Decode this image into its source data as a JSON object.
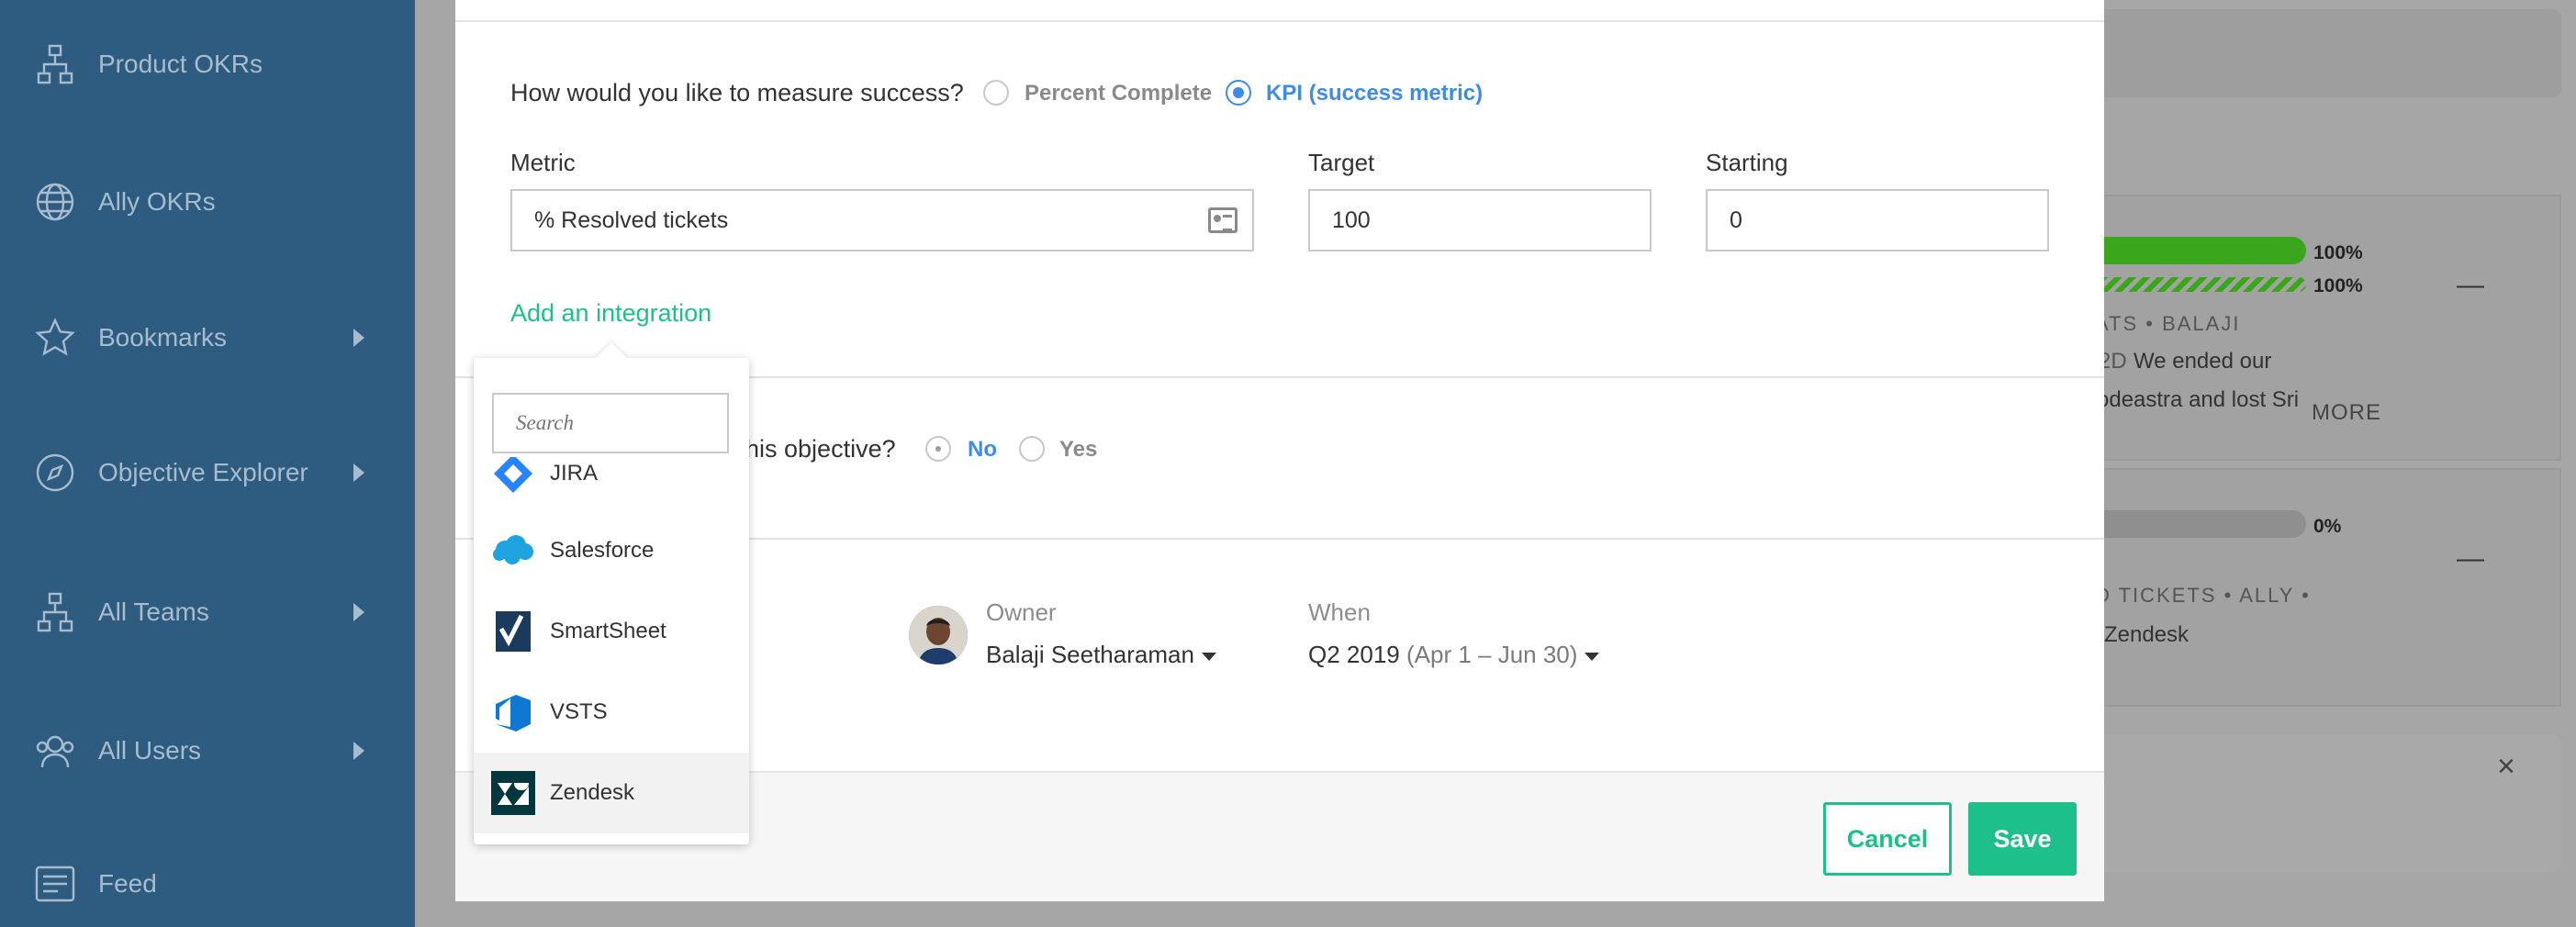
{
  "sidebar": {
    "items": [
      {
        "label": "Product OKRs",
        "icon": "org-chart-icon",
        "has_arrow": false
      },
      {
        "label": "Ally OKRs",
        "icon": "globe-icon",
        "has_arrow": false
      },
      {
        "label": "Bookmarks",
        "icon": "star-icon",
        "has_arrow": true
      },
      {
        "label": "Objective Explorer",
        "icon": "compass-icon",
        "has_arrow": true
      },
      {
        "label": "All Teams",
        "icon": "org-chart-icon",
        "has_arrow": true
      },
      {
        "label": "All Users",
        "icon": "users-icon",
        "has_arrow": true
      },
      {
        "label": "Feed",
        "icon": "feed-icon",
        "has_arrow": false
      }
    ]
  },
  "background": {
    "card1": {
      "pct1": "100%",
      "pct2": "100%",
      "caps": "ATS • BALAJI",
      "text1_tag": "2D",
      "text1": "We ended our",
      "text2": "odeastra and lost Sri",
      "more": "MORE",
      "dash": "—"
    },
    "card2": {
      "pct": "0%",
      "caps": "D TICKETS • ALLY •",
      "text": "Zendesk",
      "dash": "—"
    },
    "close": "×"
  },
  "measure": {
    "question": "How would you like to measure success?",
    "options": [
      {
        "label": "Percent Complete",
        "selected": false
      },
      {
        "label": "KPI (success metric)",
        "selected": true
      }
    ]
  },
  "fields": {
    "metric_label": "Metric",
    "metric_value": "% Resolved tickets",
    "target_label": "Target",
    "target_value": "100",
    "starting_label": "Starting",
    "starting_value": "0"
  },
  "integration_link": "Add an integration",
  "second_question": {
    "partial_text": "his objective?",
    "options": [
      {
        "label": "No",
        "selected": true
      },
      {
        "label": "Yes",
        "selected": false
      }
    ]
  },
  "owner": {
    "label": "Owner",
    "name": "Balaji Seetharaman"
  },
  "when": {
    "label": "When",
    "quarter": "Q2 2019",
    "range": "(Apr 1 – Jun 30)"
  },
  "buttons": {
    "cancel": "Cancel",
    "save": "Save"
  },
  "dropdown": {
    "search_placeholder": "Search",
    "items": [
      {
        "label": "JIRA",
        "icon": "jira-icon"
      },
      {
        "label": "Salesforce",
        "icon": "salesforce-icon"
      },
      {
        "label": "SmartSheet",
        "icon": "smartsheet-icon"
      },
      {
        "label": "VSTS",
        "icon": "vsts-icon"
      },
      {
        "label": "Zendesk",
        "icon": "zendesk-icon",
        "highlighted": true
      }
    ]
  },
  "colors": {
    "sidebar": "#2e5c80",
    "accent_green": "#1dc08a",
    "accent_blue": "#3d8de3",
    "progress_green": "#3aa61c"
  }
}
